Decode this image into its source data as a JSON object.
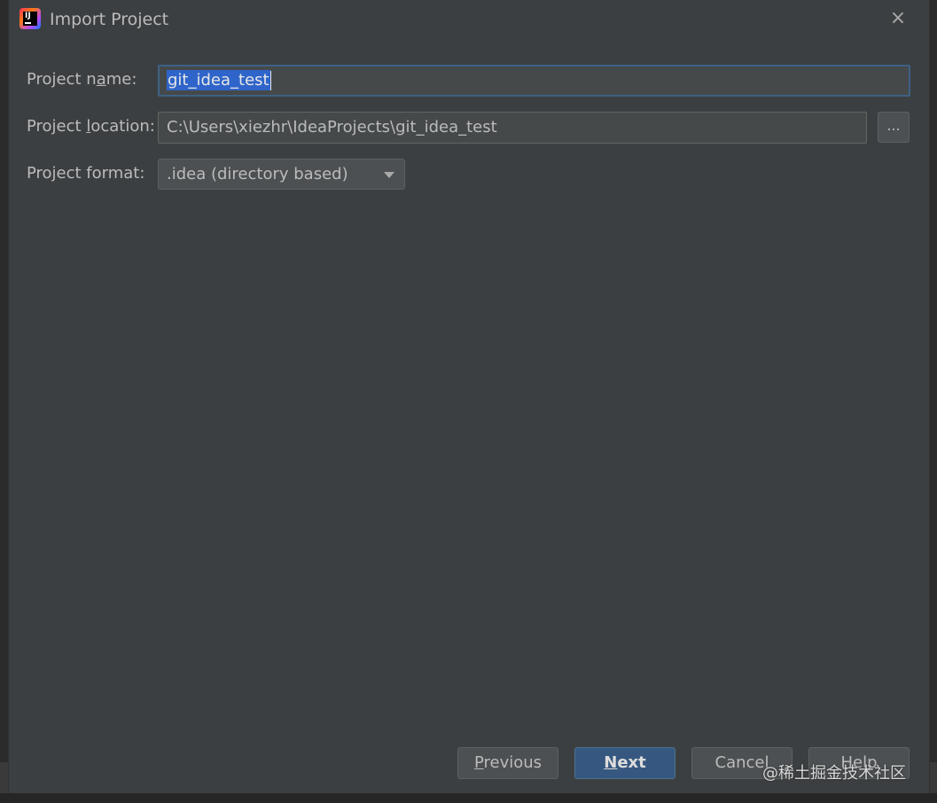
{
  "window": {
    "title": "Import Project",
    "close_icon": "×"
  },
  "form": {
    "project_name": {
      "label_pre": "Project n",
      "label_mnemonic": "a",
      "label_post": "me:",
      "value": "git_idea_test"
    },
    "project_location": {
      "label_pre": "Project ",
      "label_mnemonic": "l",
      "label_post": "ocation:",
      "value": "C:\\Users\\xiezhr\\IdeaProjects\\git_idea_test",
      "browse_label": "..."
    },
    "project_format": {
      "label": "Project format:",
      "selected": ".idea (directory based)"
    }
  },
  "buttons": {
    "previous": {
      "mnemonic": "P",
      "rest": "revious"
    },
    "next": {
      "mnemonic": "N",
      "rest": "ext"
    },
    "cancel": {
      "label": "Cancel"
    },
    "help": {
      "label": "Help"
    }
  },
  "watermark": "@稀土掘金技术社区",
  "colors": {
    "dialog_bg": "#3c3f41",
    "field_bg": "#45494a",
    "focus_border": "#3d6185",
    "selection": "#2f65ca",
    "default_button": "#365880"
  }
}
